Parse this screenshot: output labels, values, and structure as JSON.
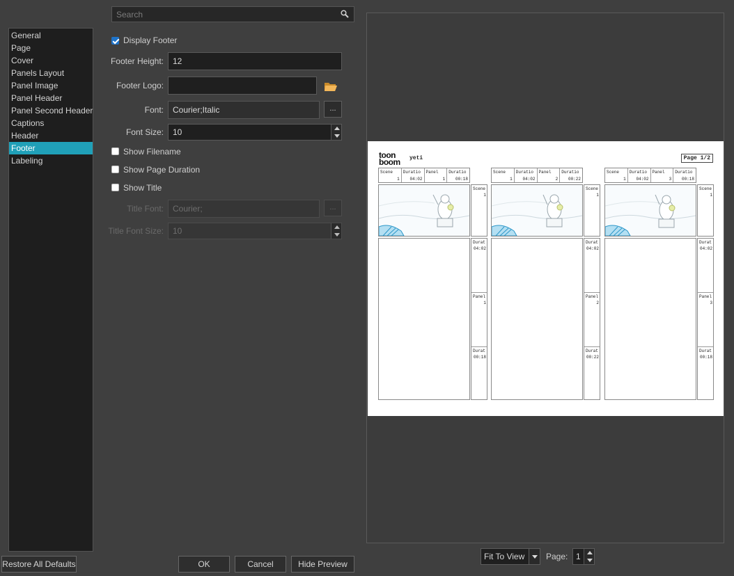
{
  "search": {
    "placeholder": "Search"
  },
  "sidebar": {
    "items": [
      {
        "label": "General"
      },
      {
        "label": "Page"
      },
      {
        "label": "Cover"
      },
      {
        "label": "Panels Layout"
      },
      {
        "label": "Panel Image"
      },
      {
        "label": "Panel Header"
      },
      {
        "label": "Panel Second Header"
      },
      {
        "label": "Captions"
      },
      {
        "label": "Header"
      },
      {
        "label": "Footer",
        "selected": true
      },
      {
        "label": "Labeling"
      }
    ]
  },
  "form": {
    "display_footer": {
      "label": "Display Footer",
      "checked": true
    },
    "footer_height": {
      "label": "Footer Height:",
      "value": "12"
    },
    "footer_logo": {
      "label": "Footer Logo:",
      "value": ""
    },
    "font": {
      "label": "Font:",
      "value": "Courier;Italic",
      "button": "..."
    },
    "font_size": {
      "label": "Font Size:",
      "value": "10"
    },
    "show_filename": {
      "label": "Show Filename",
      "checked": false
    },
    "show_page_duration": {
      "label": "Show Page Duration",
      "checked": false
    },
    "show_title": {
      "label": "Show Title",
      "checked": false
    },
    "title_font": {
      "label": "Title Font:",
      "value": "Courier;",
      "button": "..."
    },
    "title_font_size": {
      "label": "Title Font Size:",
      "value": "10"
    }
  },
  "buttons": {
    "restore": "Restore All Defaults",
    "ok": "OK",
    "cancel": "Cancel",
    "hide_preview": "Hide Preview"
  },
  "preview_controls": {
    "fit_mode": "Fit To View",
    "page_label": "Page:",
    "page_value": "1"
  },
  "preview_page": {
    "logo_text_top": "toon",
    "logo_text_bottom": "boom",
    "project": "yeti",
    "page_indicator": "Page 1/2",
    "header_titles": {
      "scene": "Scene",
      "duration": "Duratio",
      "panel": "Panel",
      "duration2": "Duratio"
    },
    "side_titles": {
      "scene": "Scene",
      "duration": "Durat",
      "panel": "Panel",
      "duration2": "Durat"
    },
    "panels": [
      {
        "scene": "1",
        "duration": "04:02",
        "panel": "1",
        "panel_duration": "00:18"
      },
      {
        "scene": "1",
        "duration": "04:02",
        "panel": "2",
        "panel_duration": "00:22"
      },
      {
        "scene": "1",
        "duration": "04:02",
        "panel": "3",
        "panel_duration": "00:18"
      }
    ]
  },
  "colors": {
    "accent": "#20a0b8",
    "checkbox": "#1e73c9",
    "folder_icon": "#e8a23a"
  }
}
